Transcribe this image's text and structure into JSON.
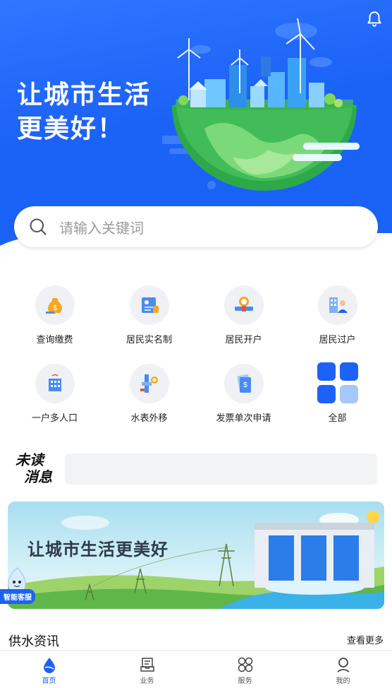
{
  "hero": {
    "slogan_line1": "让城市生活",
    "slogan_line2": "更美好！"
  },
  "search": {
    "placeholder": "请输入关键词"
  },
  "services": [
    {
      "label": "查询缴费",
      "icon": "money-bag-icon"
    },
    {
      "label": "居民实名制",
      "icon": "id-card-icon"
    },
    {
      "label": "居民开户",
      "icon": "water-meter-icon"
    },
    {
      "label": "居民过户",
      "icon": "transfer-user-icon"
    },
    {
      "label": "一户多人口",
      "icon": "building-icon"
    },
    {
      "label": "水表外移",
      "icon": "pipe-meter-icon"
    },
    {
      "label": "发票单次申请",
      "icon": "invoice-icon"
    },
    {
      "label": "全部",
      "icon": "all-grid-icon"
    }
  ],
  "unread": {
    "line1": "未读",
    "line2": "消息"
  },
  "banner": {
    "text": "让城市生活更美好"
  },
  "assistant": {
    "label": "智能客服"
  },
  "news": {
    "title": "供水资讯",
    "more": "查看更多"
  },
  "tabs": [
    {
      "label": "首页",
      "icon": "water-drop-icon",
      "active": true
    },
    {
      "label": "业务",
      "icon": "document-tray-icon",
      "active": false
    },
    {
      "label": "服务",
      "icon": "four-leaf-icon",
      "active": false
    },
    {
      "label": "我的",
      "icon": "user-icon",
      "active": false
    }
  ],
  "colors": {
    "primary": "#1d62f6",
    "grid_blue": "#1d62f6",
    "grid_light": "#a5c8f7"
  }
}
